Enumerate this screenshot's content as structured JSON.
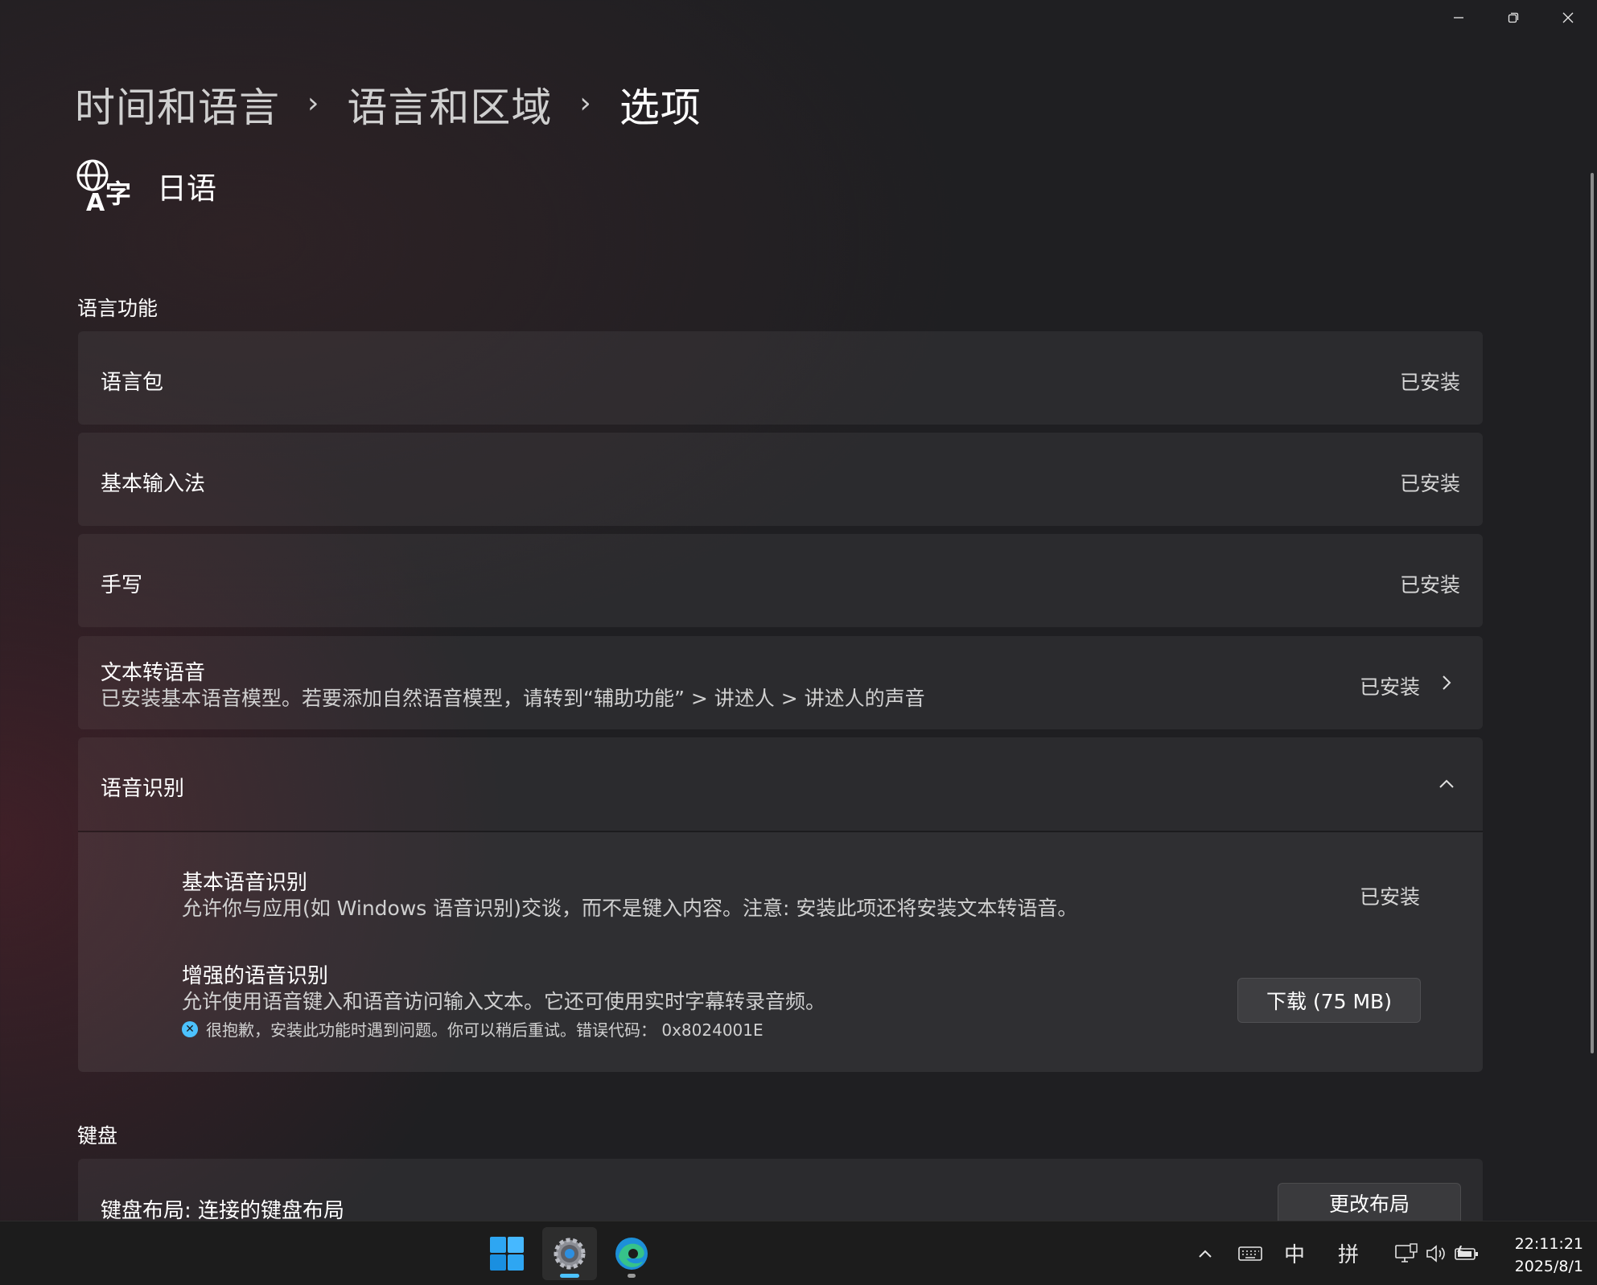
{
  "window": {
    "minimize_glyph": "─",
    "restore_glyph": "❐",
    "close_glyph": "✕"
  },
  "breadcrumb": {
    "items": [
      "时间和语言",
      "语言和区域",
      "选项"
    ],
    "separator": "›"
  },
  "language": {
    "name": "日语",
    "icon": "language-icon"
  },
  "sections": {
    "language_features": {
      "title": "语言功能",
      "rows": {
        "language_pack": {
          "title": "语言包",
          "status": "已安装"
        },
        "basic_input": {
          "title": "基本输入法",
          "status": "已安装"
        },
        "handwriting": {
          "title": "手写",
          "status": "已安装"
        },
        "tts": {
          "title": "文本转语音",
          "desc": "已安装基本语音模型。若要添加自然语音模型，请转到“辅助功能” > 讲述人 > 讲述人的声音",
          "status": "已安装"
        },
        "speech": {
          "title": "语音识别",
          "basic": {
            "title": "基本语音识别",
            "desc": "允许你与应用(如 Windows 语音识别)交谈，而不是键入内容。注意: 安装此项还将安装文本转语音。",
            "status": "已安装"
          },
          "enhanced": {
            "title": "增强的语音识别",
            "desc": "允许使用语音键入和语音访问输入文本。它还可使用实时字幕转录音频。",
            "error": "很抱歉，安装此功能时遇到问题。你可以稍后重试。错误代码： 0x8024001E",
            "download_label": "下载 (75 MB)"
          }
        }
      }
    },
    "keyboard": {
      "title": "键盘",
      "layout_title": "键盘布局: 连接的键盘布局",
      "change_label": "更改布局"
    }
  },
  "taskbar": {
    "apps": [
      "start-icon",
      "settings-icon",
      "edge-icon"
    ],
    "tray": {
      "ime_mode": "中",
      "ime_type": "拼",
      "time": "22:11:21",
      "date": "2025/8/1"
    }
  },
  "colors": {
    "accent": "#4cc2ff",
    "background": "#1f1f22"
  }
}
